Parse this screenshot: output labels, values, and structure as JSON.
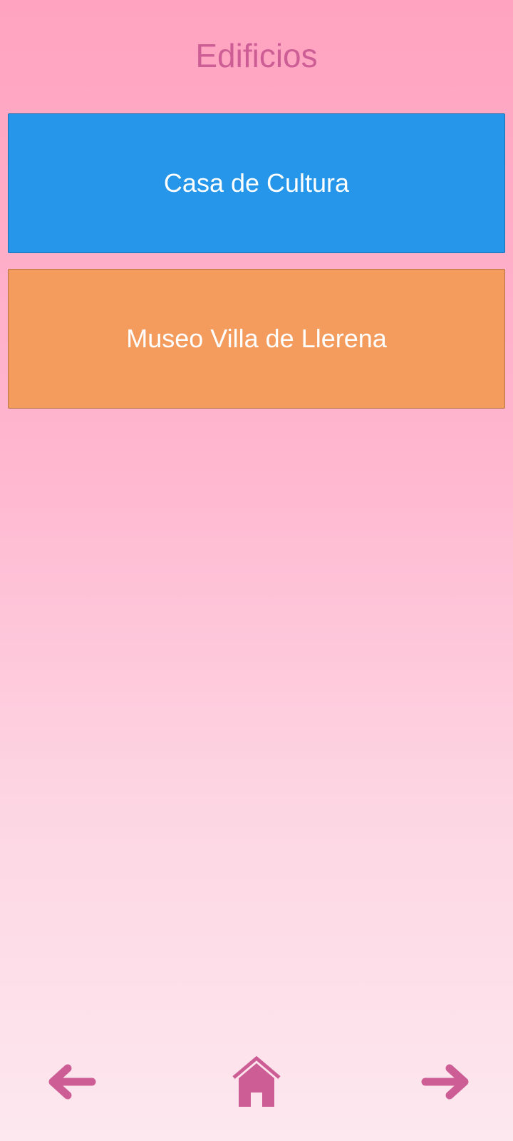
{
  "header": {
    "title": "Edificios"
  },
  "colors": {
    "accent": "#cd5e95",
    "card_text": "#ffffff"
  },
  "buildings": [
    {
      "label": "Casa de Cultura",
      "color": "#2596ea"
    },
    {
      "label": "Museo Villa de Llerena",
      "color": "#f49b5e"
    }
  ],
  "nav": {
    "back_icon": "arrow-left-icon",
    "home_icon": "home-icon",
    "next_icon": "arrow-right-icon"
  }
}
